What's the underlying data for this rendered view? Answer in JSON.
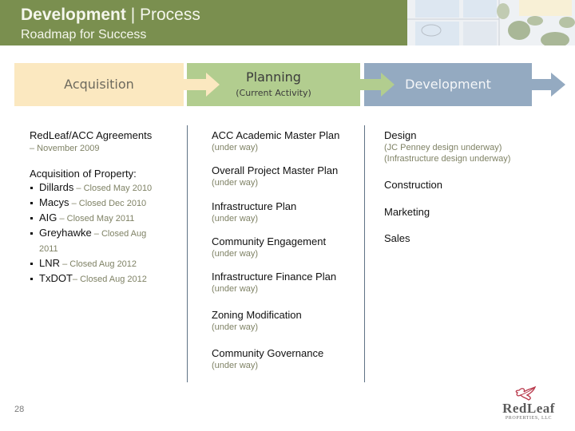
{
  "header": {
    "title_strong": "Development",
    "title_separator": " | ",
    "title_rest": "Process",
    "subtitle": "Roadmap for Success"
  },
  "stages": [
    {
      "label": "Acquisition",
      "sub": ""
    },
    {
      "label": "Planning",
      "sub": "(Current Activity)"
    },
    {
      "label": "Development",
      "sub": ""
    }
  ],
  "acquisition": {
    "agreements": {
      "title": "RedLeaf/ACC Agreements",
      "note": "– November 2009"
    },
    "property_heading": "Acquisition of Property:",
    "properties": [
      {
        "name": "Dillards",
        "note": " – Closed May 2010"
      },
      {
        "name": "Macys",
        "note": " – Closed Dec 2010"
      },
      {
        "name": "AIG",
        "note": " – Closed May 2011"
      },
      {
        "name": "Greyhawke",
        "note": " – Closed Aug 2011"
      },
      {
        "name": "LNR",
        "note": " – Closed Aug 2012"
      },
      {
        "name": "TxDOT",
        "note": "– Closed Aug 2012"
      }
    ]
  },
  "planning": {
    "items": [
      {
        "title": "ACC Academic Master Plan",
        "note": "(under way)"
      },
      {
        "title": "Overall Project Master Plan",
        "note": "(under way)"
      },
      {
        "title": "Infrastructure Plan",
        "note": "(under way)"
      },
      {
        "title": "Community Engagement",
        "note": "(under way)"
      },
      {
        "title": "Infrastructure Finance Plan",
        "note": "(under way)"
      },
      {
        "title": "Zoning Modification",
        "note": "(under way)"
      },
      {
        "title": "Community Governance",
        "note": "(under way)"
      }
    ]
  },
  "development": {
    "items": [
      {
        "title": "Design",
        "notes": [
          "(JC Penney design underway)",
          "(Infrastructure design underway)"
        ]
      },
      {
        "title": "Construction",
        "notes": []
      },
      {
        "title": "Marketing",
        "notes": []
      },
      {
        "title": "Sales",
        "notes": []
      }
    ]
  },
  "footer": {
    "page_number": "28",
    "logo_name": "RedLeaf",
    "logo_sub": "PROPERTIES, LLC"
  },
  "colors": {
    "header_green": "#7a8f4f",
    "acquisition": "#fbe8c0",
    "planning": "#b2cd8f",
    "development": "#94aac1",
    "note_text": "#7f8265",
    "logo_red": "#b8374a"
  }
}
